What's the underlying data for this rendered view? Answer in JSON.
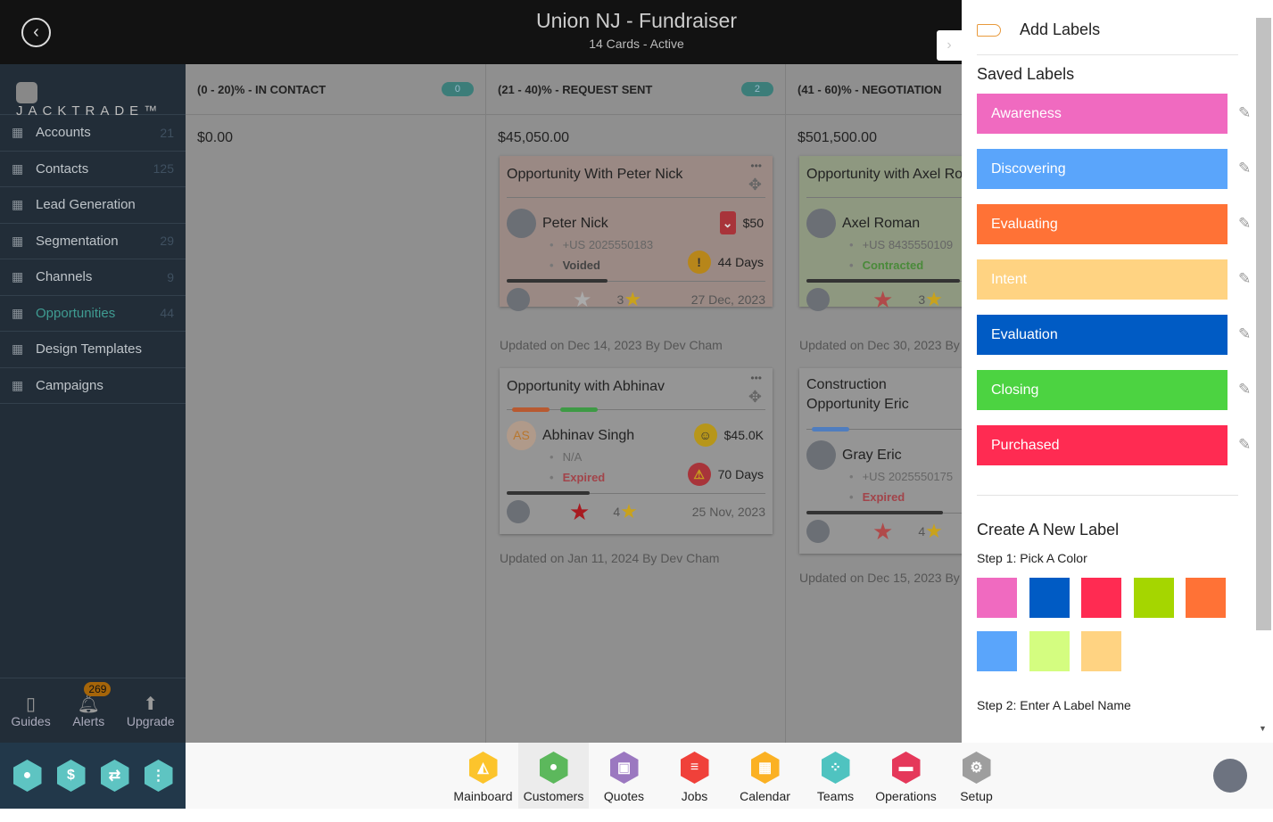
{
  "header": {
    "title": "Union NJ - Fundraiser",
    "subtitle": "14 Cards - Active"
  },
  "sidebar": {
    "brand": "JACKTRADE™",
    "items": [
      {
        "label": "Accounts",
        "count": "21",
        "icon": "building-icon"
      },
      {
        "label": "Contacts",
        "count": "125",
        "icon": "contacts-icon"
      },
      {
        "label": "Lead Generation",
        "count": "",
        "icon": "lead-icon"
      },
      {
        "label": "Segmentation",
        "count": "29",
        "icon": "segmentation-icon"
      },
      {
        "label": "Channels",
        "count": "9",
        "icon": "channels-icon"
      },
      {
        "label": "Opportunities",
        "count": "44",
        "icon": "opportunities-icon",
        "active": true
      },
      {
        "label": "Design Templates",
        "count": "",
        "icon": "templates-icon"
      },
      {
        "label": "Campaigns",
        "count": "",
        "icon": "campaigns-icon"
      }
    ],
    "bottom": {
      "guides": "Guides",
      "alerts": "Alerts",
      "alerts_count": "269",
      "upgrade": "Upgrade"
    }
  },
  "columns": [
    {
      "title": "(0 - 20)% - IN CONTACT",
      "count": "0",
      "amount": "$0.00"
    },
    {
      "title": "(21 - 40)% - REQUEST SENT",
      "count": "2",
      "amount": "$45,050.00"
    },
    {
      "title": "(41 - 60)% - NEGOTIATION",
      "amount": "$501,500.00"
    }
  ],
  "cards": [
    {
      "title": "Opportunity With Peter Nick",
      "name": "Peter Nick",
      "phone": "+US 2025550183",
      "status": "Voided",
      "value": "$50",
      "days": "44 Days",
      "rating": "3",
      "date": "27 Dec, 2023",
      "updated": "Updated on Dec 14, 2023 By Dev Cham"
    },
    {
      "title": "Opportunity with Abhinav",
      "initials": "AS",
      "name": "Abhinav Singh",
      "phone": "N/A",
      "status": "Expired",
      "value": "$45.0K",
      "days": "70 Days",
      "rating": "4",
      "date": "25 Nov, 2023",
      "updated": "Updated on Jan 11, 2024 By Dev Cham"
    },
    {
      "title": "Opportunity with Axel Ro",
      "name": "Axel Roman",
      "phone": "+US 8435550109",
      "status": "Contracted",
      "rating": "3",
      "updated": "Updated on Dec 30, 2023 By D"
    },
    {
      "title": "Construction Opportunity Eric",
      "name": "Gray Eric",
      "phone": "+US 2025550175",
      "status": "Expired",
      "rating": "4",
      "updated": "Updated on Dec 15, 2023 By D"
    }
  ],
  "panel": {
    "title": "Add Labels",
    "saved_title": "Saved Labels",
    "labels": [
      {
        "name": "Awareness",
        "color": "#f06ac0"
      },
      {
        "name": "Discovering",
        "color": "#5aa5fb"
      },
      {
        "name": "Evaluating",
        "color": "#ff7236"
      },
      {
        "name": "Intent",
        "color": "#ffd382"
      },
      {
        "name": "Evaluation",
        "color": "#005bc4"
      },
      {
        "name": "Closing",
        "color": "#4cd341"
      },
      {
        "name": "Purchased",
        "color": "#ff2b52"
      }
    ],
    "create_title": "Create A New Label",
    "step1": "Step 1: Pick A Color",
    "step2": "Step 2: Enter A Label Name",
    "swatches": [
      "#f06ac0",
      "#005bc4",
      "#ff2b52",
      "#a5d600",
      "#ff7236",
      "#5aa5fb",
      "#d4fd80",
      "#ffd382"
    ]
  },
  "apps": [
    {
      "label": "Mainboard",
      "color": "#fcc42c"
    },
    {
      "label": "Customers",
      "color": "#5cb85c",
      "selected": true
    },
    {
      "label": "Quotes",
      "color": "#9b78c0"
    },
    {
      "label": "Jobs",
      "color": "#f0413a"
    },
    {
      "label": "Calendar",
      "color": "#fbb123"
    },
    {
      "label": "Teams",
      "color": "#4fc3c0"
    },
    {
      "label": "Operations",
      "color": "#e5385a"
    },
    {
      "label": "Setup",
      "color": "#9e9e9e"
    }
  ]
}
